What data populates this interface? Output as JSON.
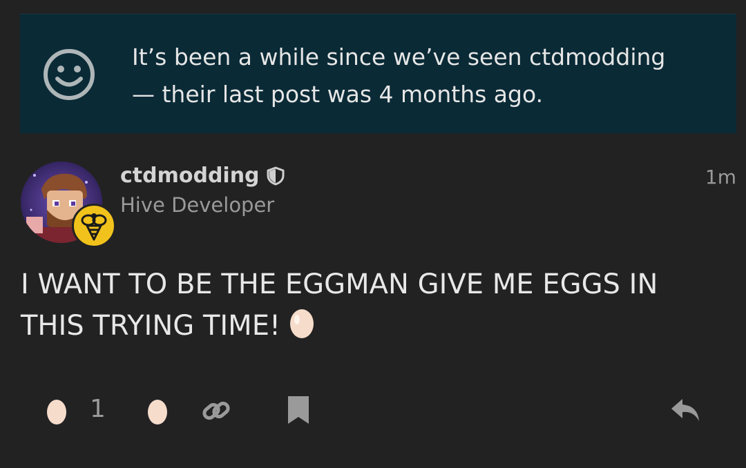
{
  "notice": {
    "line1": "It’s been a while since we’ve seen ctdmodding",
    "line2": "— their last post was 4 months ago.",
    "icon": "smiley-icon"
  },
  "post": {
    "username": "ctdmodding",
    "user_title": "Hive Developer",
    "timestamp": "1m",
    "body_line1": "I WANT TO BE THE EGGMAN GIVE ME EGGS IN",
    "body_line2": "THIS TRYING TIME!",
    "badge_icon": "bee-icon",
    "moderator_icon": "shield-icon"
  },
  "actions": {
    "reaction_count": "1",
    "icons": [
      "egg-reaction-icon",
      "egg-add-reaction-icon",
      "link-icon",
      "bookmark-icon",
      "reply-icon"
    ]
  },
  "colors": {
    "background": "#222223",
    "notice_background": "#0a2a36",
    "badge": "#f1c21b",
    "egg": "#f6dccb"
  }
}
